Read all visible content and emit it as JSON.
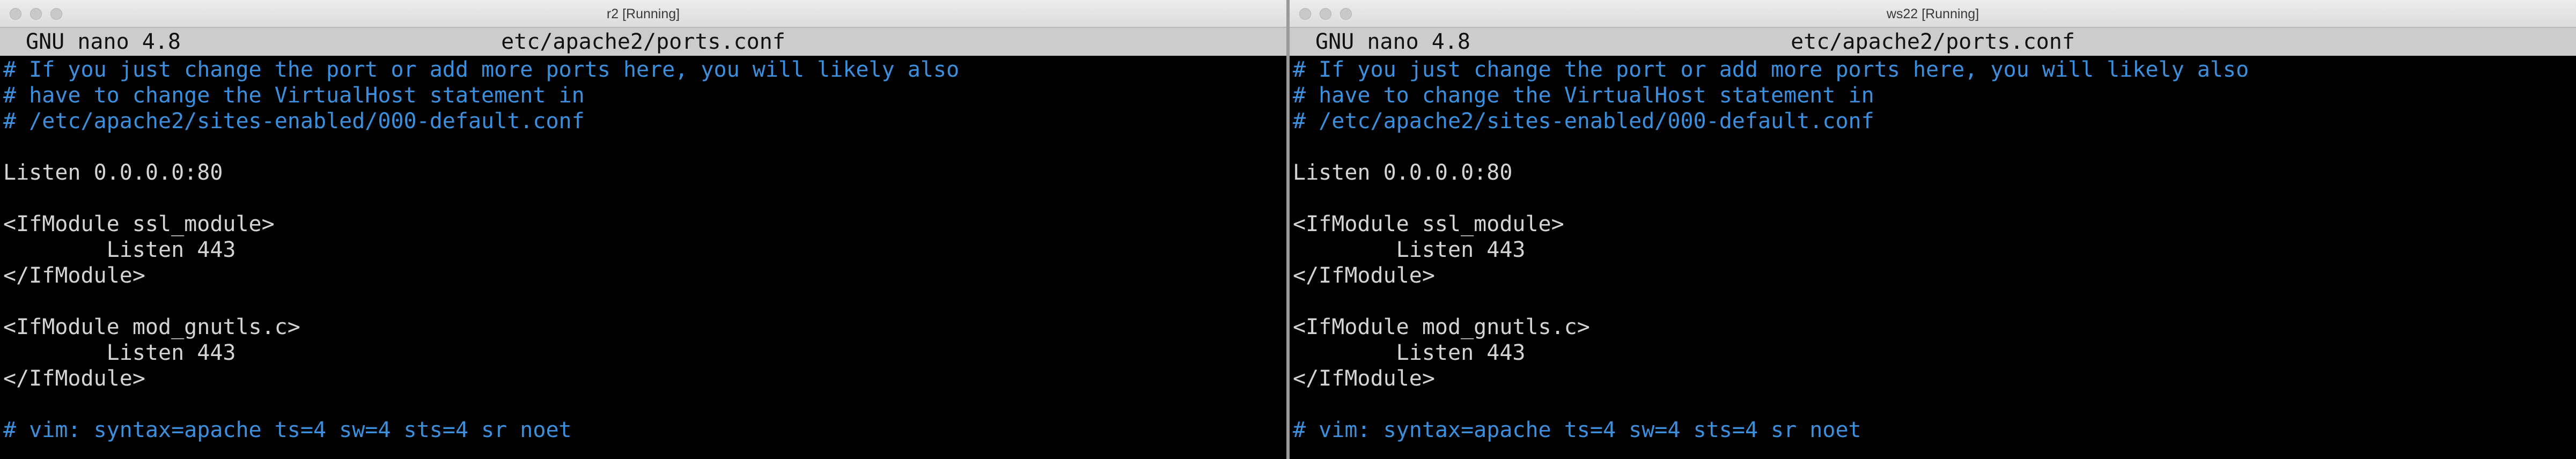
{
  "colors": {
    "background": "#000000",
    "comment": "#3b8fdc",
    "text": "#d4d4d4",
    "nano_header_bg": "#cccccc",
    "titlebar_bg": "#e4e4e4"
  },
  "windows": [
    {
      "title": "r2 [Running]",
      "nano_version": "GNU nano 4.8",
      "filename": "etc/apache2/ports.conf",
      "lines": [
        {
          "text": "# If you just change the port or add more ports here, you will likely also",
          "kind": "comment"
        },
        {
          "text": "# have to change the VirtualHost statement in",
          "kind": "comment"
        },
        {
          "text": "# /etc/apache2/sites-enabled/000-default.conf",
          "kind": "comment"
        },
        {
          "text": "",
          "kind": "code"
        },
        {
          "text": "Listen 0.0.0.0:80",
          "kind": "code"
        },
        {
          "text": "",
          "kind": "code"
        },
        {
          "text": "<IfModule ssl_module>",
          "kind": "code"
        },
        {
          "text": "        Listen 443",
          "kind": "code"
        },
        {
          "text": "</IfModule>",
          "kind": "code"
        },
        {
          "text": "",
          "kind": "code"
        },
        {
          "text": "<IfModule mod_gnutls.c>",
          "kind": "code"
        },
        {
          "text": "        Listen 443",
          "kind": "code"
        },
        {
          "text": "</IfModule>",
          "kind": "code"
        },
        {
          "text": "",
          "kind": "code"
        },
        {
          "text": "# vim: syntax=apache ts=4 sw=4 sts=4 sr noet",
          "kind": "comment"
        }
      ]
    },
    {
      "title": "ws22 [Running]",
      "nano_version": "GNU nano 4.8",
      "filename": "etc/apache2/ports.conf",
      "lines": [
        {
          "text": "# If you just change the port or add more ports here, you will likely also",
          "kind": "comment"
        },
        {
          "text": "# have to change the VirtualHost statement in",
          "kind": "comment"
        },
        {
          "text": "# /etc/apache2/sites-enabled/000-default.conf",
          "kind": "comment"
        },
        {
          "text": "",
          "kind": "code"
        },
        {
          "text": "Listen 0.0.0.0:80",
          "kind": "code"
        },
        {
          "text": "",
          "kind": "code"
        },
        {
          "text": "<IfModule ssl_module>",
          "kind": "code"
        },
        {
          "text": "        Listen 443",
          "kind": "code"
        },
        {
          "text": "</IfModule>",
          "kind": "code"
        },
        {
          "text": "",
          "kind": "code"
        },
        {
          "text": "<IfModule mod_gnutls.c>",
          "kind": "code"
        },
        {
          "text": "        Listen 443",
          "kind": "code"
        },
        {
          "text": "</IfModule>",
          "kind": "code"
        },
        {
          "text": "",
          "kind": "code"
        },
        {
          "text": "# vim: syntax=apache ts=4 sw=4 sts=4 sr noet",
          "kind": "comment"
        }
      ]
    }
  ]
}
